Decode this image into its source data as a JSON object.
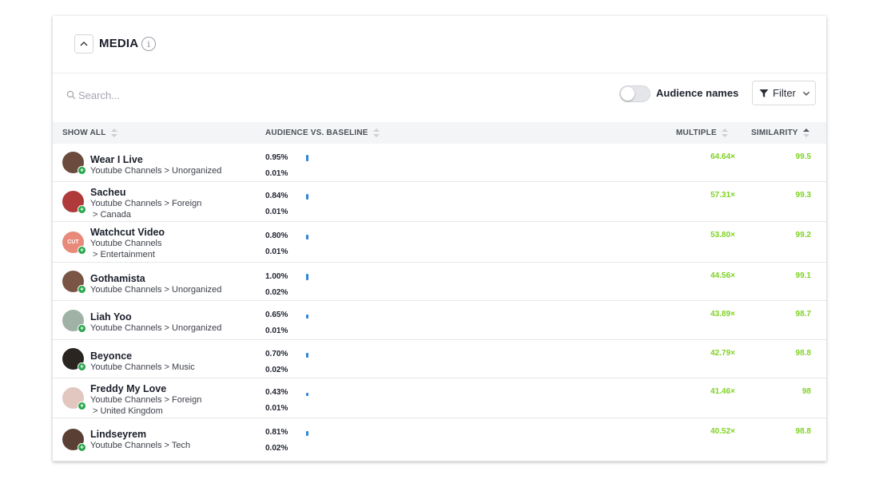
{
  "header": {
    "title": "MEDIA",
    "info": "i"
  },
  "toolbar": {
    "search_placeholder": "Search...",
    "toggle_label": "Audience names",
    "filter_label": "Filter"
  },
  "columns": {
    "show_all": "SHOW ALL",
    "audience": "AUDIENCE VS. BASELINE",
    "multiple": "MULTIPLE",
    "similarity": "SIMILARITY"
  },
  "colors": {
    "accent_green": "#7ed321",
    "bar_blue": "#2f86d6",
    "badge_green": "#22a447"
  },
  "rows": [
    {
      "name": "Wear I Live",
      "cat1": "Youtube Channels > Unorganized",
      "cat2": "",
      "aud": "0.95%",
      "base": "0.01%",
      "multiple": "64.64×",
      "similarity": "99.5",
      "avatar_color": "#6b4b3e",
      "bar_level": 0.95
    },
    {
      "name": "Sacheu",
      "cat1": "Youtube Channels > Foreign",
      "cat2": "> Canada",
      "aud": "0.84%",
      "base": "0.01%",
      "multiple": "57.31×",
      "similarity": "99.3",
      "avatar_color": "#b03a3a",
      "bar_level": 0.84
    },
    {
      "name": "Watchcut Video",
      "cat1": "Youtube Channels",
      "cat2": "> Entertainment",
      "aud": "0.80%",
      "base": "0.01%",
      "multiple": "53.80×",
      "similarity": "99.2",
      "avatar_color": "#e8897a",
      "avatar_text": "CUT",
      "bar_level": 0.8
    },
    {
      "name": "Gothamista",
      "cat1": "Youtube Channels > Unorganized",
      "cat2": "",
      "aud": "1.00%",
      "base": "0.02%",
      "multiple": "44.56×",
      "similarity": "99.1",
      "avatar_color": "#7a5545",
      "bar_level": 1.0
    },
    {
      "name": "Liah Yoo",
      "cat1": "Youtube Channels > Unorganized",
      "cat2": "",
      "aud": "0.65%",
      "base": "0.01%",
      "multiple": "43.89×",
      "similarity": "98.7",
      "avatar_color": "#9fb2a5",
      "bar_level": 0.65
    },
    {
      "name": "Beyonce",
      "cat1": "Youtube Channels > Music",
      "cat2": "",
      "aud": "0.70%",
      "base": "0.02%",
      "multiple": "42.79×",
      "similarity": "98.8",
      "avatar_color": "#2b2522",
      "bar_level": 0.7
    },
    {
      "name": "Freddy My Love",
      "cat1": "Youtube Channels > Foreign",
      "cat2": "> United Kingdom",
      "aud": "0.43%",
      "base": "0.01%",
      "multiple": "41.46×",
      "similarity": "98",
      "avatar_color": "#e2c6c0",
      "bar_level": 0.43
    },
    {
      "name": "Lindseyrem",
      "cat1": "Youtube Channels > Tech",
      "cat2": "",
      "aud": "0.81%",
      "base": "0.02%",
      "multiple": "40.52×",
      "similarity": "98.8",
      "avatar_color": "#5a4034",
      "bar_level": 0.81
    }
  ]
}
